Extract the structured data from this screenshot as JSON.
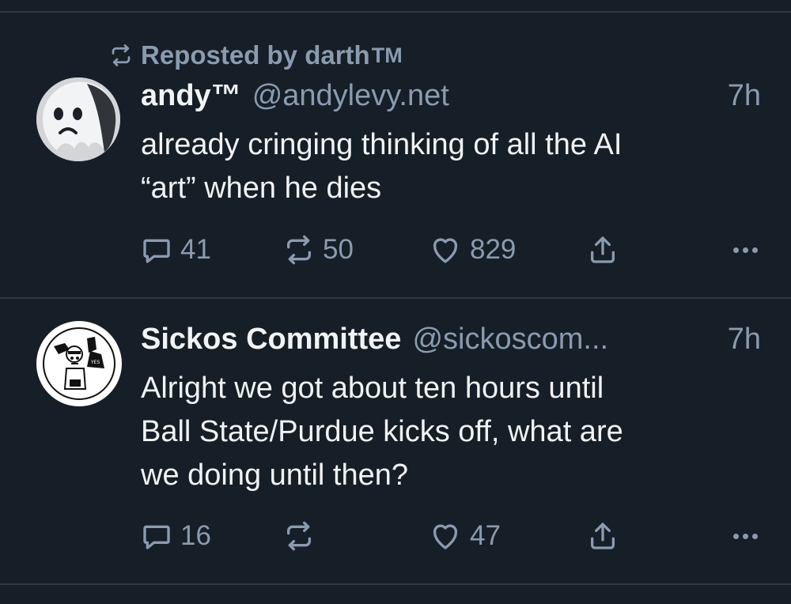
{
  "colors": {
    "background": "#161e27",
    "divider": "#2c3947",
    "primary_text": "#f1f3f5",
    "secondary_text": "#8a9bb0"
  },
  "posts": [
    {
      "repost_label": "Reposted by darth",
      "repost_suffix": "TM",
      "repost_icon": "repost-icon",
      "avatar_icon": "ghost-avatar",
      "display_name": "andy™",
      "handle": "@andylevy.net",
      "time": "7h",
      "text_line_1": "already cringing thinking of all the AI",
      "text_line_2": "“art” when he dies",
      "replies": "41",
      "reposts": "50",
      "likes": "829"
    },
    {
      "avatar_icon": "sickos-logo-avatar",
      "display_name": "Sickos Committee",
      "handle": "@sickoscom...",
      "time": "7h",
      "text_line_1": "Alright we got about ten hours until",
      "text_line_2": "Ball State/Purdue kicks off, what are",
      "text_line_3": "we doing until then?",
      "replies": "16",
      "reposts": "",
      "likes": "47"
    }
  ]
}
